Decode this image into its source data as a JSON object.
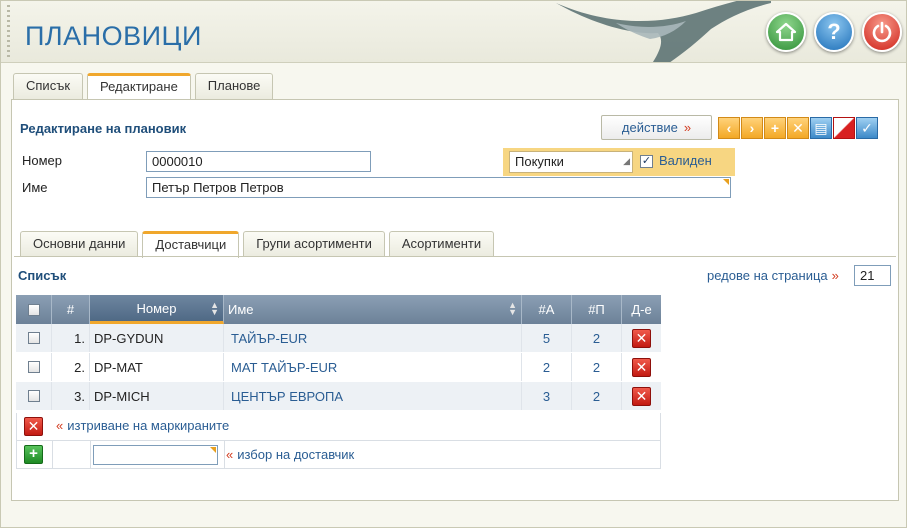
{
  "app": {
    "title": "ПЛАНОВИЦИ"
  },
  "main_tabs": [
    {
      "label": "Списък"
    },
    {
      "label": "Редактиране",
      "active": true
    },
    {
      "label": "Планове"
    }
  ],
  "form": {
    "title": "Редактиране на плановик",
    "action_label": "действие",
    "arrow": "»",
    "number_label": "Номер",
    "number_value": "0000010",
    "name_label": "Име",
    "name_value": "Петър Петров Петров",
    "type_value": "Покупки",
    "valid_label": "Валиден",
    "valid_checked": true
  },
  "sub_tabs": [
    {
      "label": "Основни данни"
    },
    {
      "label": "Доставчици",
      "active": true
    },
    {
      "label": "Групи асортименти"
    },
    {
      "label": "Асортименти"
    }
  ],
  "list": {
    "title": "Списък",
    "rows_per_page_label": "редове на страница",
    "rows_per_page_value": "21",
    "columns": {
      "num": "#",
      "code": "Номер",
      "name": "Име",
      "a": "#А",
      "p": "#П",
      "d": "Д-е"
    },
    "rows": [
      {
        "num": "1.",
        "code": "DP-GYDUN",
        "name": "ТАЙЪР-EUR",
        "a": "5",
        "p": "2"
      },
      {
        "num": "2.",
        "code": "DP-MAT",
        "name": "МАТ ТАЙЪР-EUR",
        "a": "2",
        "p": "2"
      },
      {
        "num": "3.",
        "code": "DP-MICH",
        "name": "ЦЕНТЪР ЕВРОПА",
        "a": "3",
        "p": "2"
      }
    ],
    "delete_marked_label": "изтриване на маркираните",
    "choose_supplier_label": "избор на доставчик",
    "raquo": "«"
  },
  "colors": {
    "accent": "#f0a72c",
    "title_blue": "#2a6ea8",
    "link_blue": "#2a5d93",
    "grid_header": "#7a8ea5"
  }
}
